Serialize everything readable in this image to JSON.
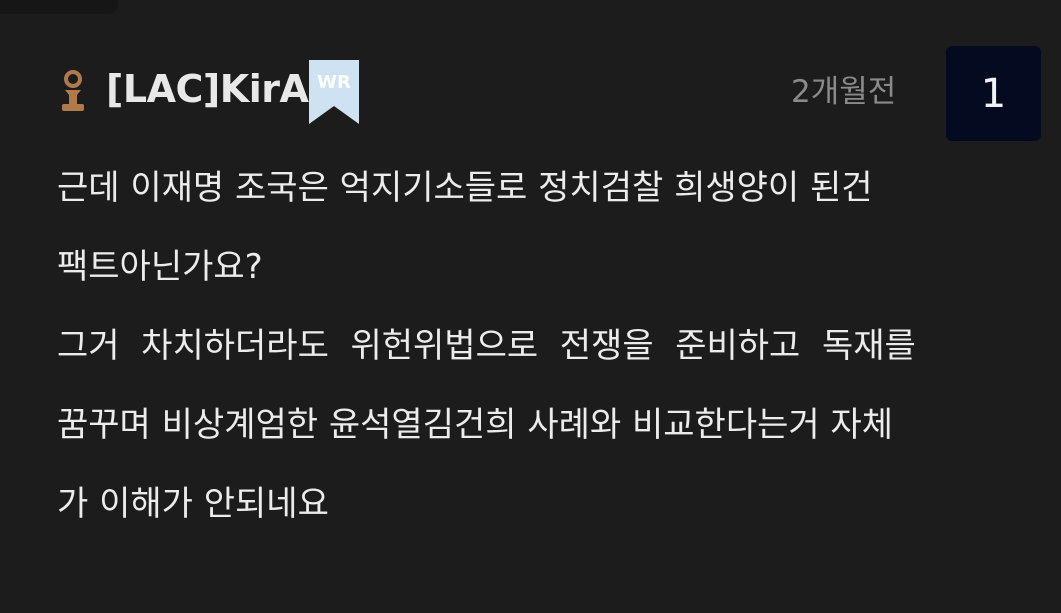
{
  "comment": {
    "author": "[LAC]KirA",
    "badge": "WR",
    "time": "2개월전",
    "votes": "1",
    "lines": [
      "근데 이재명 조국은 억지기소들로 정치검찰 희생양이 된건",
      "팩트아닌가요?",
      "그거  차치하더라도  위헌위법으로  전쟁을  준비하고  독재를",
      "꿈꾸며 비상계엄한 윤석열김건희 사례와 비교한다는거 자체",
      "가 이해가 안되네요"
    ]
  },
  "icons": {
    "rank": "rank-person-icon",
    "badge": "wr-bookmark-badge-icon"
  },
  "colors": {
    "background": "#1c1c1c",
    "text": "#ececec",
    "muted": "#8a8a8a",
    "rank_icon": "#b07a4a",
    "badge": "#cfe2f3",
    "vote_bg": "#040a20"
  }
}
